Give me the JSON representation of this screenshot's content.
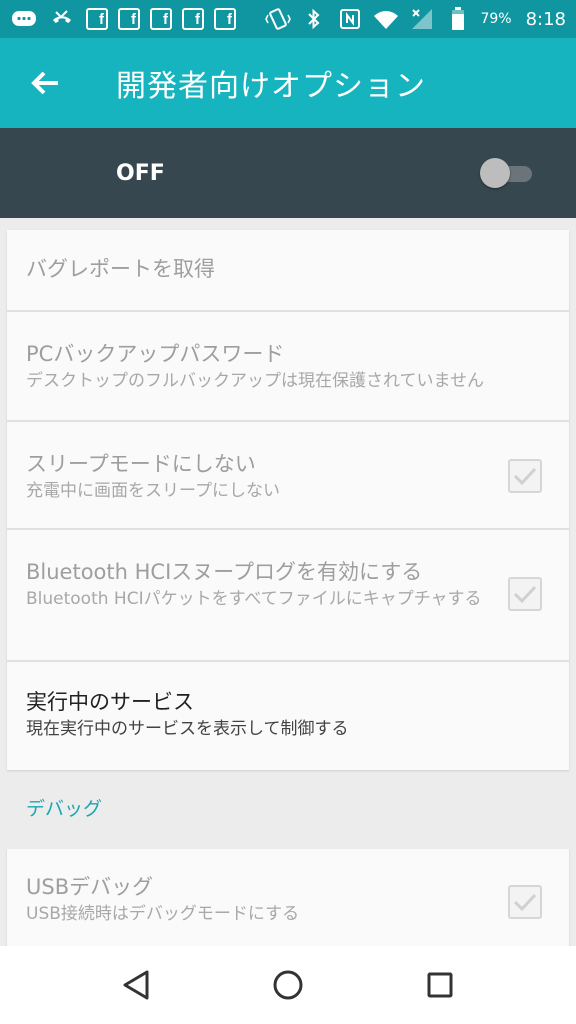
{
  "status_bar": {
    "battery_percent": "79%",
    "time": "8:18",
    "fb_letter": "f",
    "icons": [
      "message-icon",
      "missed-call-icon",
      "facebook-icon",
      "facebook-icon",
      "facebook-icon",
      "facebook-icon",
      "facebook-icon",
      "vibrate-icon",
      "bluetooth-icon",
      "nfc-icon",
      "wifi-icon",
      "signal-icon",
      "battery-icon"
    ]
  },
  "app_bar": {
    "title": "開発者向けオプション",
    "back_icon": "arrow-back-icon"
  },
  "master_switch": {
    "label": "OFF",
    "state": "off"
  },
  "settings": {
    "bug_report": {
      "title": "バグレポートを取得"
    },
    "pc_backup_password": {
      "title": "PCバックアップパスワード",
      "summary": "デスクトップのフルバックアップは現在保護されていません"
    },
    "stay_awake": {
      "title": "スリープモードにしない",
      "summary": "充電中に画面をスリープにしない",
      "checked": true
    },
    "bt_hci_snoop": {
      "title": "Bluetooth HCIスヌープログを有効にする",
      "summary": "Bluetooth HCIパケットをすべてファイルにキャプチャする",
      "checked": true
    },
    "running_services": {
      "title": "実行中のサービス",
      "summary": "現在実行中のサービスを表示して制御する"
    }
  },
  "debugging": {
    "header": "デバッグ",
    "usb_debugging": {
      "title": "USBデバッグ",
      "summary": "USB接続時はデバッグモードにする",
      "checked": true
    }
  },
  "nav_bar": {
    "icons": [
      "back-triangle-icon",
      "home-circle-icon",
      "recents-square-icon"
    ]
  },
  "colors": {
    "status_bar": "#0f96a0",
    "app_bar": "#15b4bf",
    "master_row": "#37474f",
    "accent": "#1aa6b0"
  }
}
